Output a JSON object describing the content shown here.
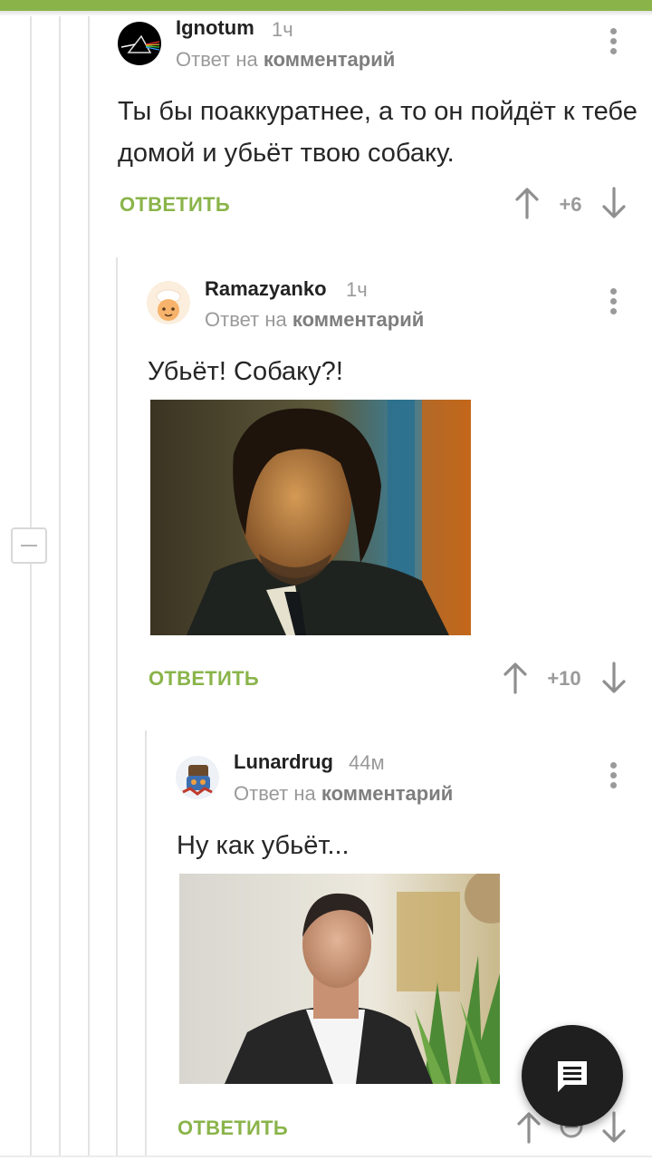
{
  "comments": [
    {
      "username": "Ignotum",
      "time": "1ч",
      "reply_prefix": "Ответ на",
      "reply_target": "комментарий",
      "text": "Ты бы поаккуратнее, а то он пойдёт к тебе домой и убьёт твою собаку.",
      "reply_label": "ОТВЕТИТЬ",
      "rating": "+6"
    },
    {
      "username": "Ramazyanko",
      "time": "1ч",
      "reply_prefix": "Ответ на",
      "reply_target": "комментарий",
      "text": "Убьёт! Собаку?!",
      "reply_label": "ОТВЕТИТЬ",
      "rating": "+10"
    },
    {
      "username": "Lunardrug",
      "time": "44м",
      "reply_prefix": "Ответ на",
      "reply_target": "комментарий",
      "text": "Ну как убьёт...",
      "reply_label": "ОТВЕТИТЬ",
      "rating": ""
    }
  ],
  "colors": {
    "accent": "#8ab44a",
    "muted": "#9a9a9a",
    "fab": "#1f1f1f"
  },
  "icons": {
    "upvote": "arrow-up-icon",
    "downvote": "arrow-down-icon",
    "menu": "more-vertical-icon",
    "collapse": "minus-icon",
    "comment_fab": "comment-icon"
  }
}
